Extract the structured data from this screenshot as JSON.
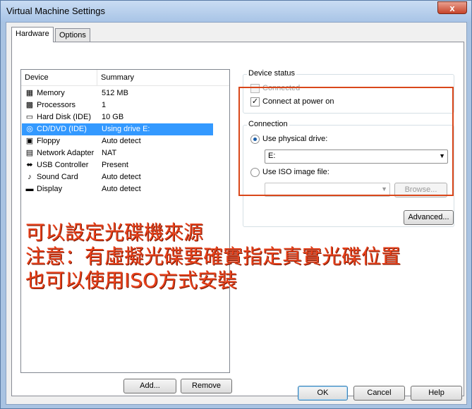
{
  "window": {
    "title": "Virtual Machine Settings",
    "close_symbol": "x"
  },
  "tabs": [
    {
      "label": "Hardware"
    },
    {
      "label": "Options"
    }
  ],
  "device_list": {
    "headers": {
      "device": "Device",
      "summary": "Summary"
    },
    "rows": [
      {
        "icon": "memory-icon",
        "name": "Memory",
        "summary": "512 MB"
      },
      {
        "icon": "processor-icon",
        "name": "Processors",
        "summary": "1"
      },
      {
        "icon": "hard-disk-icon",
        "name": "Hard Disk (IDE)",
        "summary": "10 GB"
      },
      {
        "icon": "cd-dvd-icon",
        "name": "CD/DVD (IDE)",
        "summary": "Using drive E:"
      },
      {
        "icon": "floppy-icon",
        "name": "Floppy",
        "summary": "Auto detect"
      },
      {
        "icon": "network-adapter-icon",
        "name": "Network Adapter",
        "summary": "NAT"
      },
      {
        "icon": "usb-controller-icon",
        "name": "USB Controller",
        "summary": "Present"
      },
      {
        "icon": "sound-card-icon",
        "name": "Sound Card",
        "summary": "Auto detect"
      },
      {
        "icon": "display-icon",
        "name": "Display",
        "summary": "Auto detect"
      }
    ],
    "selected_index": 3
  },
  "buttons": {
    "add": "Add...",
    "remove": "Remove",
    "ok": "OK",
    "cancel": "Cancel",
    "help": "Help",
    "browse": "Browse...",
    "advanced": "Advanced..."
  },
  "device_status": {
    "title": "Device status",
    "connected": {
      "label": "Connected",
      "checked": false,
      "disabled": true
    },
    "connect_at_power_on": {
      "label": "Connect at power on",
      "checked": true
    }
  },
  "connection": {
    "title": "Connection",
    "use_physical_drive": {
      "label": "Use physical drive:",
      "selected": true
    },
    "physical_drive_value": "E:",
    "use_iso": {
      "label": "Use ISO image file:",
      "selected": false
    },
    "iso_value": ""
  },
  "annotation": {
    "lines": [
      "可以設定光碟機來源",
      "注意：有虛擬光碟要確實指定真實光碟位置",
      "也可以使用ISO方式安裝"
    ],
    "color": "#e8411b"
  },
  "colors": {
    "selection": "#3399ff",
    "highlight_box": "#d9471a"
  }
}
